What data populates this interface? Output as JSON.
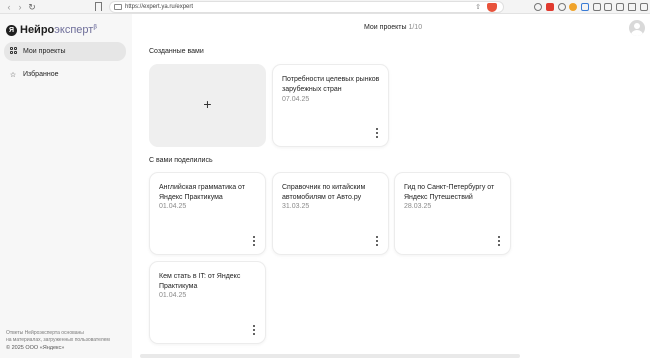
{
  "browser": {
    "url": "https://expert.ya.ru/expert",
    "shield_count": "2"
  },
  "sidebar": {
    "logo_mark": "Я",
    "logo_main": "Нейро",
    "logo_light": "эксперт",
    "logo_beta": "β",
    "items": [
      {
        "label": "Мои проекты",
        "icon": "grid-icon",
        "active": true
      },
      {
        "label": "Избранное",
        "icon": "star-icon",
        "active": false
      }
    ],
    "footer_line1": "Ответы Нейроэксперта основаны",
    "footer_line2": "на материалах, загруженных пользователем",
    "copyright": "© 2025 ООО «Яндекс»"
  },
  "header": {
    "title": "Мои проекты",
    "count": "1/10"
  },
  "created": {
    "title": "Созданные вами",
    "new_label": "+",
    "cards": [
      {
        "title": "Потребности целевых рынков зарубежных стран",
        "date": "07.04.25"
      }
    ]
  },
  "shared": {
    "title": "С вами поделились",
    "cards": [
      {
        "title": "Английская грамматика от Яндекс Практикума",
        "date": "01.04.25"
      },
      {
        "title": "Справочник по китайским автомобилям от Авто.ру",
        "date": "31.03.25"
      },
      {
        "title": "Гид по Санкт-Петербургу от Яндекс Путешествий",
        "date": "28.03.25"
      },
      {
        "title": "Кем стать в IT: от Яндекс Практикума",
        "date": "01.04.25"
      }
    ]
  }
}
